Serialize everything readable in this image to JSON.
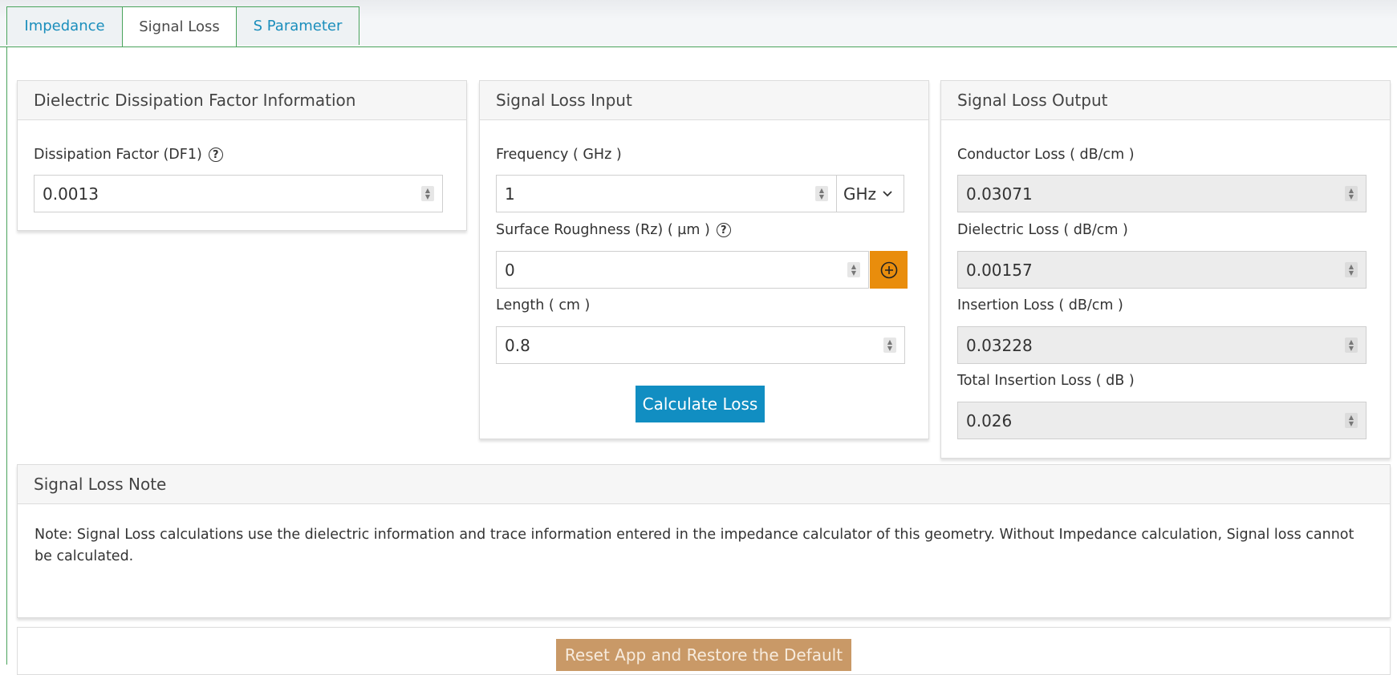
{
  "tabs": [
    {
      "label": "Impedance",
      "active": false
    },
    {
      "label": "Signal Loss",
      "active": true
    },
    {
      "label": "S Parameter",
      "active": false
    }
  ],
  "dissipation_panel": {
    "title": "Dielectric Dissipation Factor Information",
    "df_label": "Dissipation Factor (DF1)",
    "df_value": "0.0013"
  },
  "input_panel": {
    "title": "Signal Loss Input",
    "frequency_label": "Frequency ( GHz )",
    "frequency_value": "1",
    "frequency_unit": "GHz",
    "roughness_label": "Surface Roughness (Rz) ( µm )",
    "roughness_value": "0",
    "length_label": "Length ( cm )",
    "length_value": "0.8",
    "calculate_label": "Calculate Loss"
  },
  "output_panel": {
    "title": "Signal Loss Output",
    "conductor_label": "Conductor Loss ( dB/cm )",
    "conductor_value": "0.03071",
    "dielectric_label": "Dielectric Loss ( dB/cm )",
    "dielectric_value": "0.00157",
    "insertion_label": "Insertion Loss ( dB/cm )",
    "insertion_value": "0.03228",
    "total_label": "Total Insertion Loss ( dB )",
    "total_value": "0.026"
  },
  "note_panel": {
    "title": "Signal Loss Note",
    "text": "Note: Signal Loss calculations use the dielectric information and trace information entered in the impedance calculator of this geometry. Without Impedance calculation, Signal loss cannot be calculated."
  },
  "reset_label": "Reset App and Restore the Default",
  "colors": {
    "tab_border": "#4aa35c",
    "tab_text": "#1a8ebc",
    "calc_button": "#118ec2",
    "add_button": "#e98d0c",
    "reset_button": "#c99967"
  }
}
